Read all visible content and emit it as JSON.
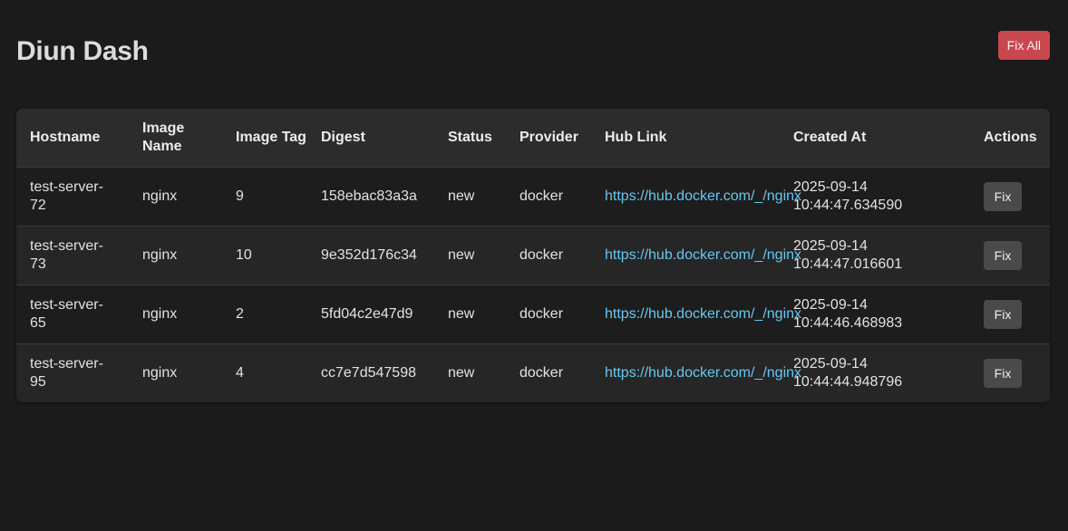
{
  "header": {
    "title": "Diun Dash",
    "fix_all_label": "Fix All"
  },
  "colors": {
    "background": "#1b1b1b",
    "fix_all_button": "#c9474f",
    "link": "#66c7f0",
    "row_button": "#4a4a4a"
  },
  "table": {
    "columns": [
      "Hostname",
      "Image Name",
      "Image Tag",
      "Digest",
      "Status",
      "Provider",
      "Hub Link",
      "Created At",
      "Actions"
    ],
    "rows": [
      {
        "hostname": "test-server-72",
        "image_name": "nginx",
        "image_tag": "9",
        "digest": "158ebac83a3a",
        "status": "new",
        "provider": "docker",
        "hub_link": "https://hub.docker.com/_/nginx",
        "created_at": "2025-09-14 10:44:47.634590",
        "action_label": "Fix"
      },
      {
        "hostname": "test-server-73",
        "image_name": "nginx",
        "image_tag": "10",
        "digest": "9e352d176c34",
        "status": "new",
        "provider": "docker",
        "hub_link": "https://hub.docker.com/_/nginx",
        "created_at": "2025-09-14 10:44:47.016601",
        "action_label": "Fix"
      },
      {
        "hostname": "test-server-65",
        "image_name": "nginx",
        "image_tag": "2",
        "digest": "5fd04c2e47d9",
        "status": "new",
        "provider": "docker",
        "hub_link": "https://hub.docker.com/_/nginx",
        "created_at": "2025-09-14 10:44:46.468983",
        "action_label": "Fix"
      },
      {
        "hostname": "test-server-95",
        "image_name": "nginx",
        "image_tag": "4",
        "digest": "cc7e7d547598",
        "status": "new",
        "provider": "docker",
        "hub_link": "https://hub.docker.com/_/nginx",
        "created_at": "2025-09-14 10:44:44.948796",
        "action_label": "Fix"
      }
    ]
  }
}
